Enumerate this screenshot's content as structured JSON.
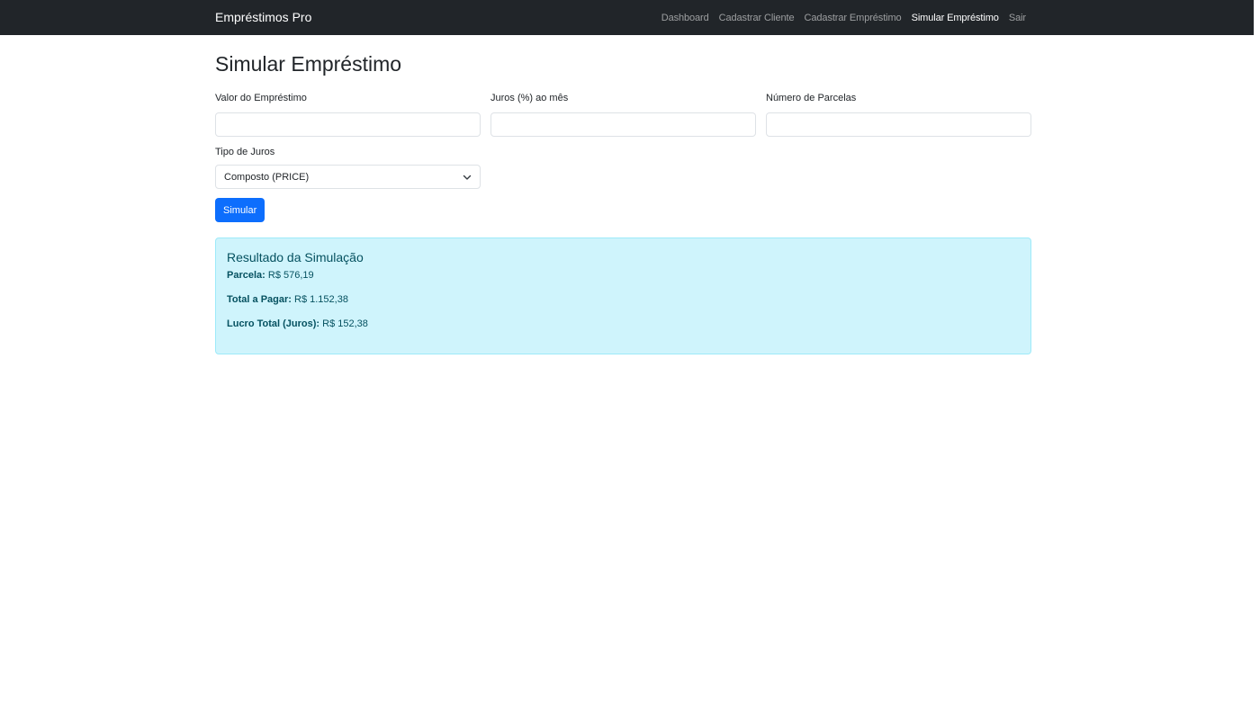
{
  "navbar": {
    "brand": "Empréstimos Pro",
    "links": [
      {
        "label": "Dashboard",
        "active": false
      },
      {
        "label": "Cadastrar Cliente",
        "active": false
      },
      {
        "label": "Cadastrar Empréstimo",
        "active": false
      },
      {
        "label": "Simular Empréstimo",
        "active": true
      },
      {
        "label": "Sair",
        "active": false
      }
    ]
  },
  "page": {
    "title": "Simular Empréstimo"
  },
  "form": {
    "valor": {
      "label": "Valor do Empréstimo",
      "value": "",
      "placeholder": ""
    },
    "juros": {
      "label": "Juros (%) ao mês",
      "value": "",
      "placeholder": ""
    },
    "parcelas": {
      "label": "Número de Parcelas",
      "value": "",
      "placeholder": ""
    },
    "tipo": {
      "label": "Tipo de Juros",
      "selected": "Composto (PRICE)"
    },
    "submit_label": "Simular"
  },
  "result": {
    "title": "Resultado da Simulação",
    "parcela": {
      "label": "Parcela:",
      "value": "R$ 576,19"
    },
    "total": {
      "label": "Total a Pagar:",
      "value": "R$ 1.152,38"
    },
    "lucro": {
      "label": "Lucro Total (Juros):",
      "value": "R$ 152,38"
    }
  },
  "colors": {
    "navbar_bg": "#212529",
    "primary": "#0d6efd",
    "alert_bg": "#cff4fc",
    "alert_border": "#9eeaf9",
    "alert_text": "#055160"
  },
  "icons": {
    "select_caret": "chevron-down-icon"
  }
}
